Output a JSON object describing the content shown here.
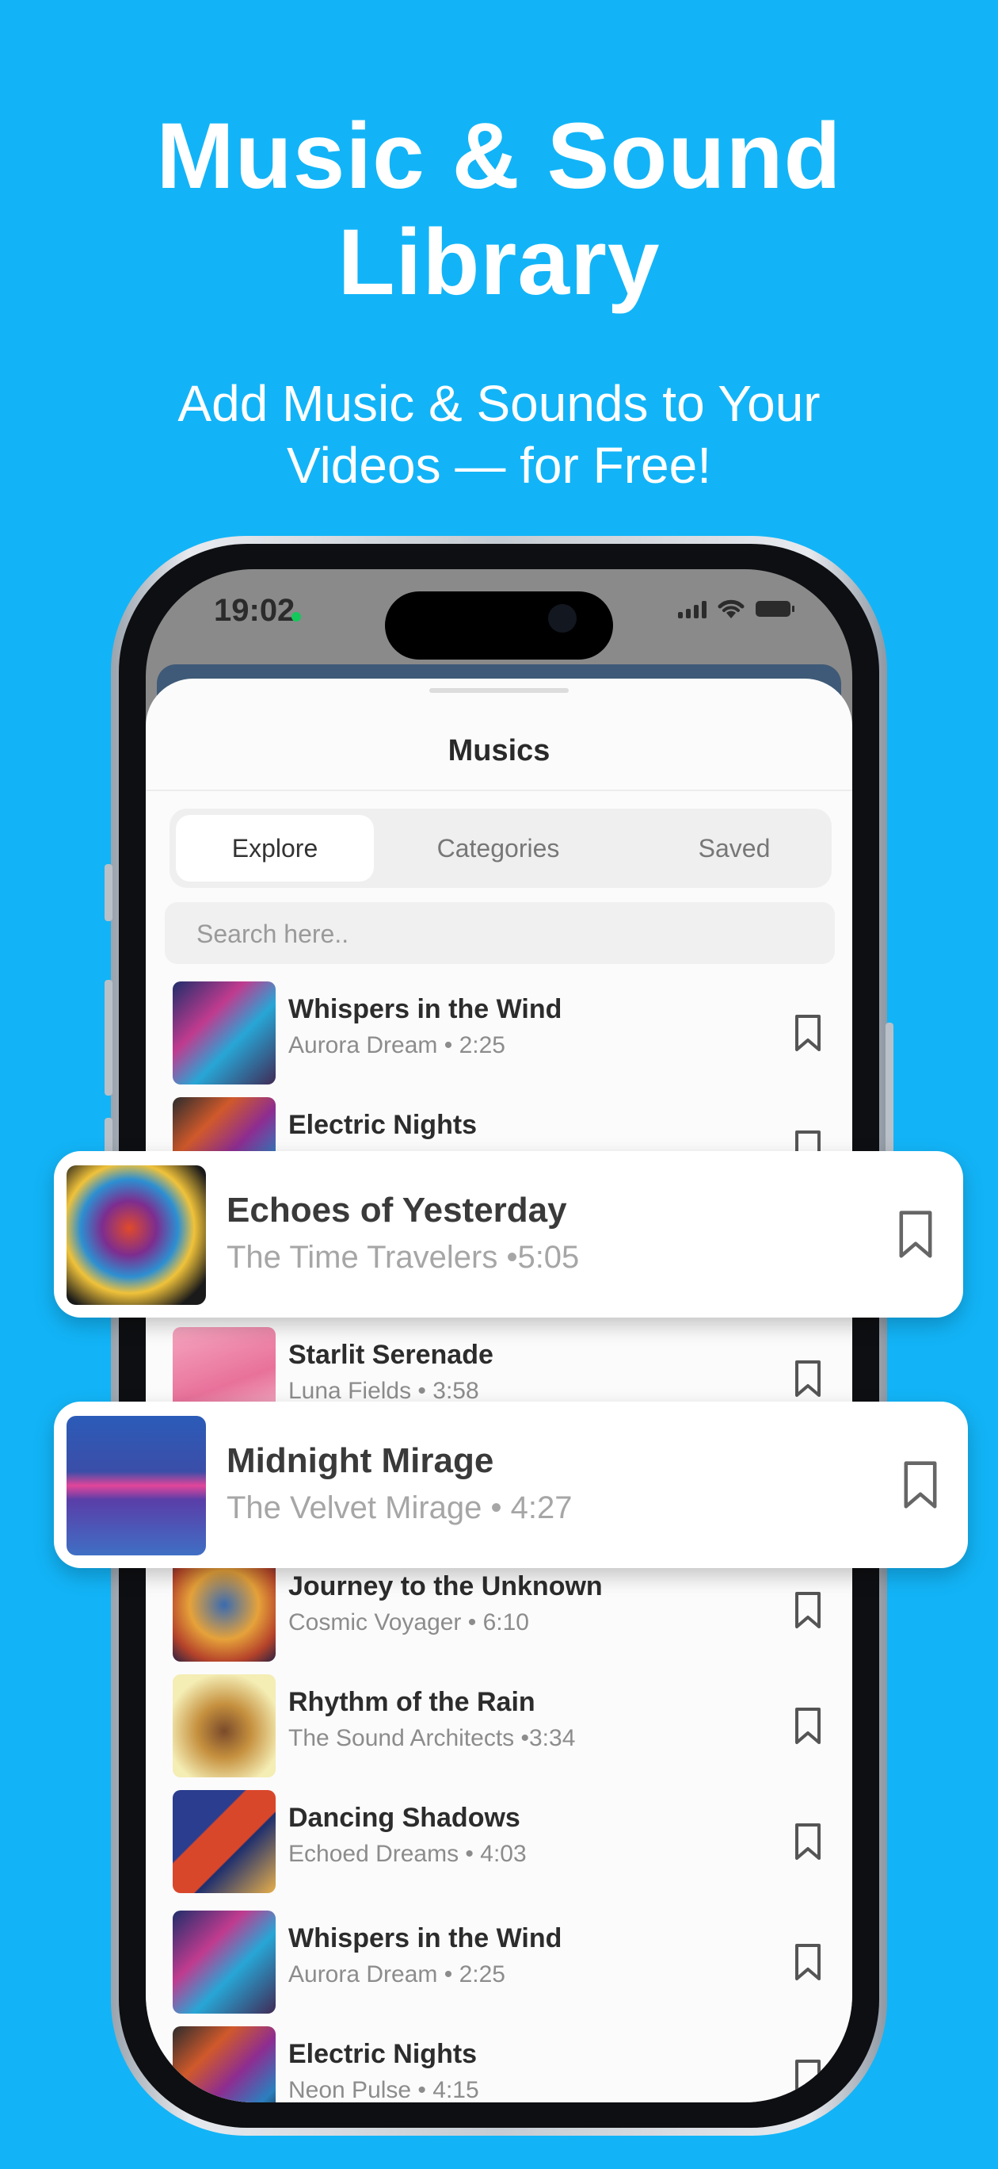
{
  "promo": {
    "headline_line1": "Music & Sound",
    "headline_line2": "Library",
    "subheadline_line1": "Add Music & Sounds to Your",
    "subheadline_line2": "Videos — for Free!"
  },
  "status_bar": {
    "time": "19:02",
    "icons": [
      "cellular-signal-icon",
      "wifi-icon",
      "battery-icon"
    ]
  },
  "sheet": {
    "title": "Musics",
    "tabs": [
      {
        "label": "Explore",
        "active": true
      },
      {
        "label": "Categories",
        "active": false
      },
      {
        "label": "Saved",
        "active": false
      }
    ],
    "search_placeholder": "Search here.."
  },
  "tracks": [
    {
      "title": "Whispers in the Wind",
      "meta": "Aurora Dream • 2:25",
      "art": "headphones-art-icon"
    },
    {
      "title": "Electric Nights",
      "meta": "",
      "art": "headphones-art-icon"
    },
    {
      "title": "Starlit Serenade",
      "meta": "Luna Fields • 3:58",
      "art": "pink-art-icon"
    },
    {
      "title": "Journey to the Unknown",
      "meta": "Cosmic Voyager • 6:10",
      "art": "cosmic-art-icon"
    },
    {
      "title": "Rhythm of the Rain",
      "meta": "The Sound Architects •3:34",
      "art": "guitar-art-icon"
    },
    {
      "title": "Dancing Shadows",
      "meta": "Echoed Dreams • 4:03",
      "art": "abstract-art-icon"
    },
    {
      "title": "Whispers in the Wind",
      "meta": "Aurora Dream • 2:25",
      "art": "headphones-art-icon"
    },
    {
      "title": "Electric Nights",
      "meta": "Neon Pulse • 4:15",
      "art": "headphones-art-icon"
    }
  ],
  "highlighted_tracks": [
    {
      "title": "Echoes of Yesterday",
      "meta": "The Time Travelers •5:05",
      "art": "headphones-art-icon"
    },
    {
      "title": "Midnight Mirage",
      "meta": "The Velvet Mirage • 4:27",
      "art": "soundwave-art-icon"
    }
  ],
  "colors": {
    "background": "#12b4f7",
    "sheet": "#fbfbfb",
    "text_dark": "#2c2c2c",
    "text_muted": "#8c8c8c"
  }
}
